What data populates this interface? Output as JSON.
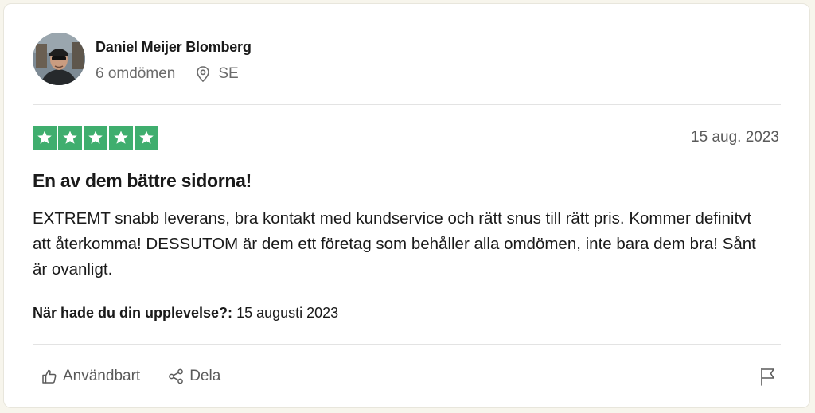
{
  "reviewer": {
    "name": "Daniel Meijer Blomberg",
    "review_count": "6 omdömen",
    "country": "SE"
  },
  "review": {
    "rating": 5,
    "rating_max": 5,
    "star_color": "#3fae6e",
    "date": "15 aug. 2023",
    "title": "En av dem bättre sidorna!",
    "body": "EXTREMT snabb leverans, bra kontakt med kundservice och rätt snus till rätt pris. Kommer definitvt att återkomma! DESSUTOM är dem ett företag som behåller alla omdömen, inte bara dem bra! Sånt är ovanligt.",
    "experience_label": "När hade du din upplevelse?:",
    "experience_date": "15 augusti 2023"
  },
  "actions": {
    "useful_label": "Användbart",
    "share_label": "Dela",
    "useful_icon": "thumbs-up-icon",
    "share_icon": "share-icon",
    "report_icon": "flag-icon"
  }
}
